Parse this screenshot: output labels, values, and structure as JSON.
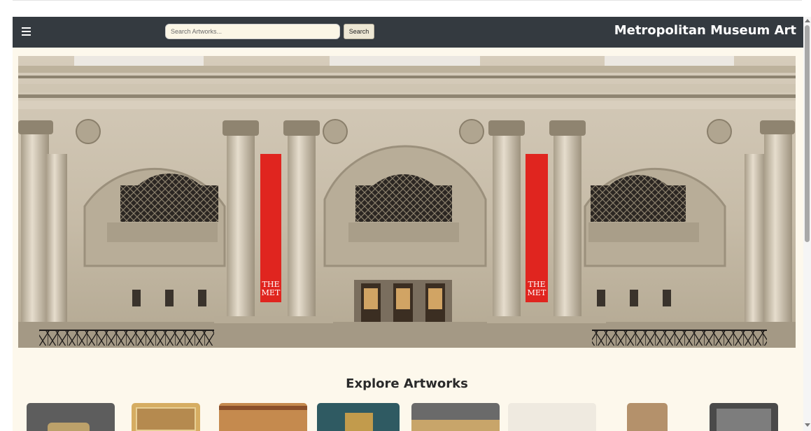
{
  "navbar": {
    "menu_icon": "hamburger-icon",
    "search_placeholder": "Search Artworks...",
    "search_value": "",
    "search_button_label": "Search",
    "title": "Metropolitan Museum Art"
  },
  "hero": {
    "banner_text_line1": "THE",
    "banner_text_line2": "MET"
  },
  "main": {
    "section_title": "Explore Artworks"
  },
  "colors": {
    "navbar_bg": "#343a40",
    "page_bg": "#fdf8ec",
    "banner_red": "#e0251f"
  }
}
